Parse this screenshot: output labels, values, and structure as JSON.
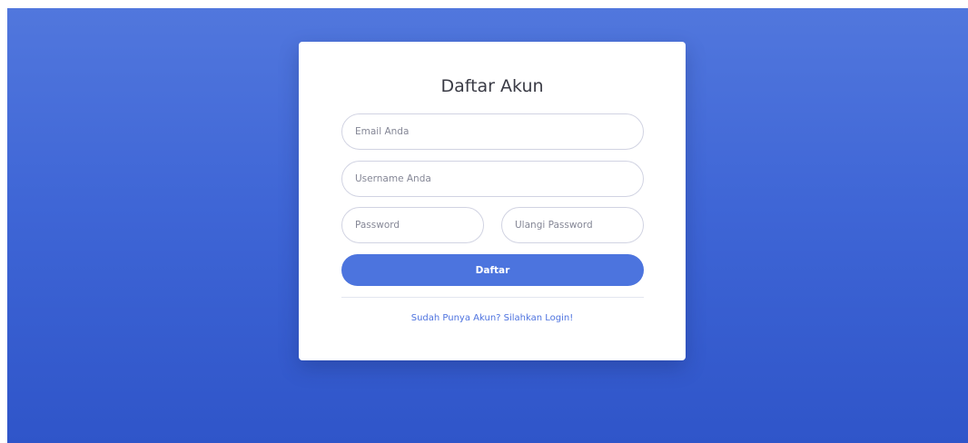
{
  "register": {
    "title": "Daftar Akun",
    "email_placeholder": "Email Anda",
    "username_placeholder": "Username Anda",
    "password_placeholder": "Password",
    "repeat_password_placeholder": "Ulangi Password",
    "submit_label": "Daftar",
    "login_link_text": "Sudah Punya Akun? Silahkan Login!"
  },
  "colors": {
    "background_top": "#5177dd",
    "background_bottom": "#2f55c9",
    "button": "#4c74de",
    "link": "#4e73df",
    "card": "#ffffff"
  }
}
